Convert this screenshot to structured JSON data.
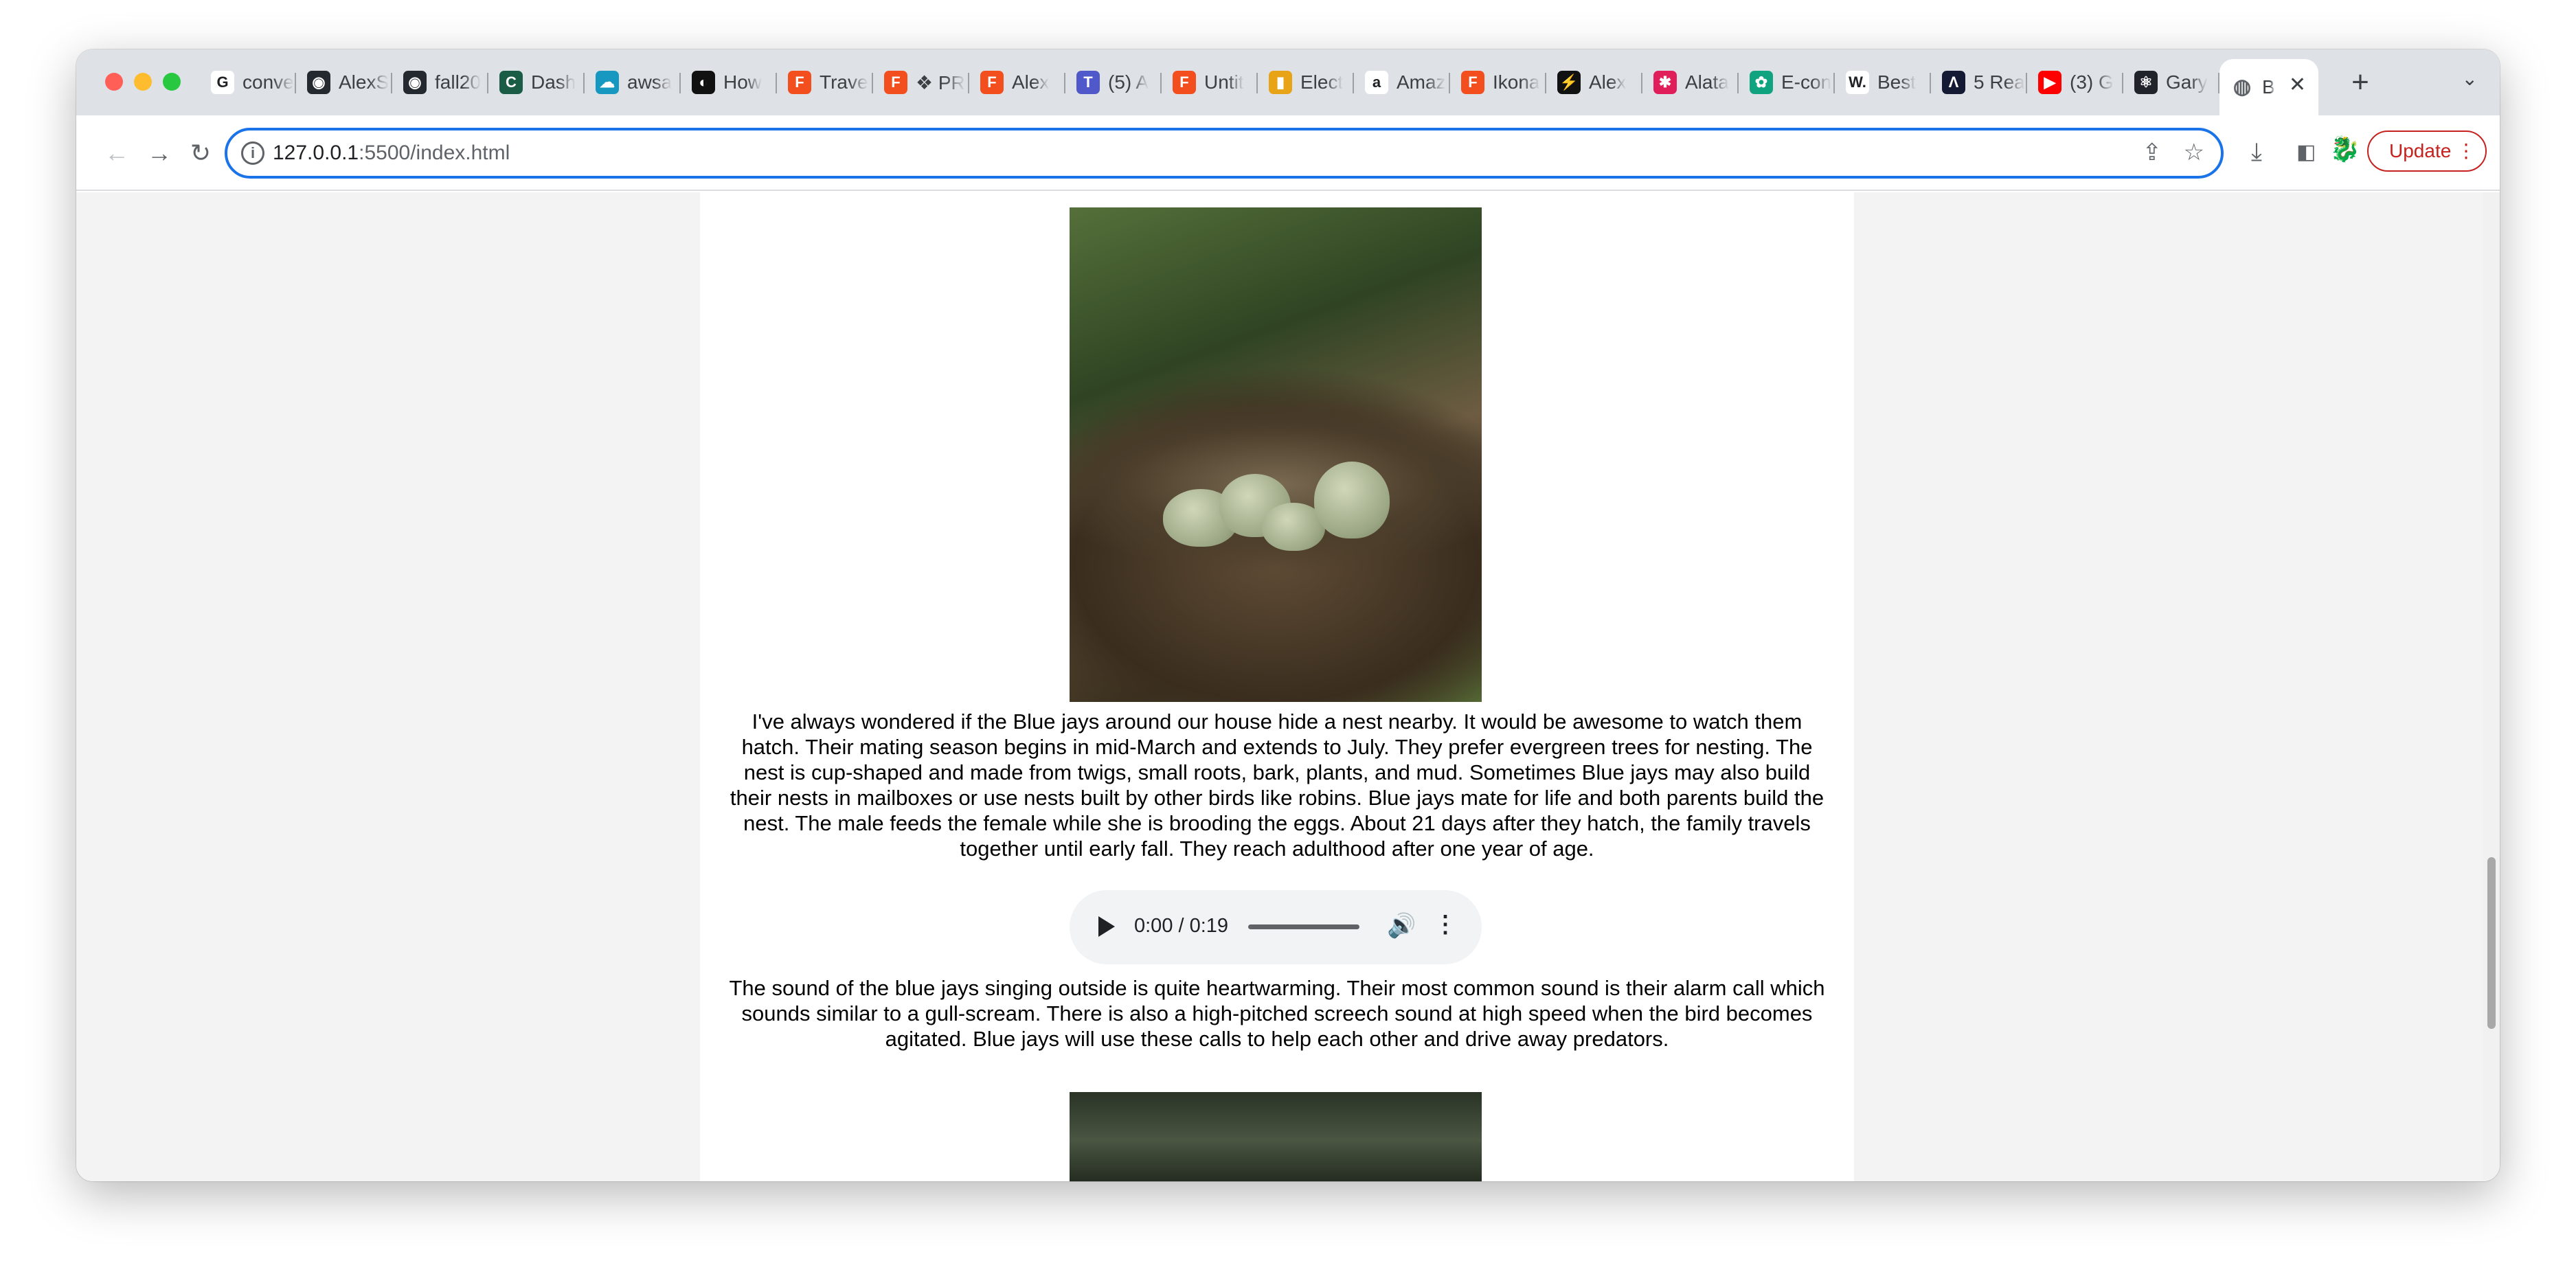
{
  "browser": {
    "tabs": [
      {
        "label": "conve",
        "icon": "google-icon",
        "color": "#ffffff",
        "glyph": "G"
      },
      {
        "label": "AlexS",
        "icon": "github-icon",
        "color": "#24292f",
        "glyph": "◉"
      },
      {
        "label": "fall20",
        "icon": "github-icon",
        "color": "#24292f",
        "glyph": "◉"
      },
      {
        "label": "Dash",
        "icon": "codesignal-icon",
        "color": "#1a5c46",
        "glyph": "C"
      },
      {
        "label": "awsa",
        "icon": "salesforce-icon",
        "color": "#1798c1",
        "glyph": "☁"
      },
      {
        "label": "How",
        "icon": "medium-icon",
        "color": "#111111",
        "glyph": "◐"
      },
      {
        "label": "Trave",
        "icon": "figma-icon",
        "color": "#f24e1e",
        "glyph": "F"
      },
      {
        "label": "❖ PR",
        "icon": "figma-icon",
        "color": "#f24e1e",
        "glyph": "F"
      },
      {
        "label": "Alex",
        "icon": "figma-icon",
        "color": "#f24e1e",
        "glyph": "F"
      },
      {
        "label": "(5) A",
        "icon": "teams-icon",
        "color": "#5059c9",
        "glyph": "T"
      },
      {
        "label": "Untit",
        "icon": "figma-icon",
        "color": "#f24e1e",
        "glyph": "F"
      },
      {
        "label": "Elect",
        "icon": "shop-icon",
        "color": "#e8a317",
        "glyph": "▮"
      },
      {
        "label": "Amaz",
        "icon": "amazon-icon",
        "color": "#ffffff",
        "glyph": "a"
      },
      {
        "label": "Ikona",
        "icon": "figma-icon",
        "color": "#f24e1e",
        "glyph": "F"
      },
      {
        "label": "Alex",
        "icon": "framer-icon",
        "color": "#111111",
        "glyph": "⚡"
      },
      {
        "label": "Alata",
        "icon": "slack-icon",
        "color": "#e01e5a",
        "glyph": "✱"
      },
      {
        "label": "E-con",
        "icon": "openai-icon",
        "color": "#10a37f",
        "glyph": "✿"
      },
      {
        "label": "Best",
        "icon": "wix-icon",
        "color": "#ffffff",
        "glyph": "W."
      },
      {
        "label": "5 Rea",
        "icon": "webflow-icon",
        "color": "#141a33",
        "glyph": "Λ"
      },
      {
        "label": "(3) G",
        "icon": "youtube-icon",
        "color": "#ff0000",
        "glyph": "▶"
      },
      {
        "label": "Gary",
        "icon": "react-icon",
        "color": "#20232a",
        "glyph": "⚛"
      }
    ],
    "active_tab": {
      "label": "B",
      "icon": "globe-icon",
      "close_icon": "close-icon"
    },
    "new_tab_glyph": "+",
    "tab_list_glyph": "⌄",
    "nav": {
      "back": "←",
      "forward": "→",
      "reload": "↻"
    },
    "url": {
      "host": "127.0.0.1",
      "path": ":5500/index.html"
    },
    "omnibox_icons": {
      "share": "⇪",
      "bookmark": "☆"
    },
    "toolbar_icons": {
      "download": "⤓",
      "side_panel": "▮",
      "extension": "🐉"
    },
    "update_label": "Update",
    "update_more": "⋮"
  },
  "page": {
    "paragraph_1": "I've always wondered if the Blue jays around our house hide a nest nearby. It would be awesome to watch them hatch. Their mating season begins in mid-March and extends to July. They prefer evergreen trees for nesting. The nest is cup-shaped and made from twigs, small roots, bark, plants, and mud. Sometimes Blue jays may also build their nests in mailboxes or use nests built by other birds like robins. Blue jays mate for life and both parents build the nest. The male feeds the female while she is brooding the eggs. About 21 days after they hatch, the family travels together until early fall. They reach adulthood after one year of age.",
    "audio": {
      "time": "0:00 / 0:19",
      "volume_glyph": "🔊",
      "more_glyph": "⋮"
    },
    "paragraph_2": "The sound of the blue jays singing outside is quite heartwarming. Their most common sound is their alarm call which sounds similar to a gull-scream. There is also a high-pitched screech sound at high speed when the bird becomes agitated. Blue jays will use these calls to help each other and drive away predators."
  }
}
